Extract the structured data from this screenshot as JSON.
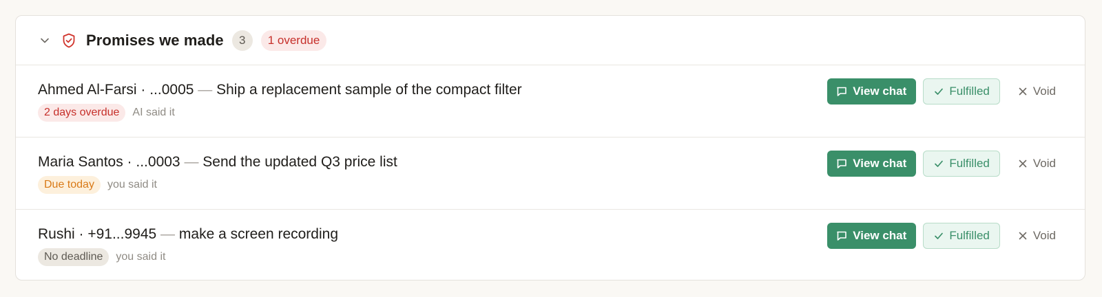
{
  "colors": {
    "accent": "#3a8f69",
    "danger": "#c62f2a",
    "warning": "#d97a17",
    "neutral_text": "#5e5a53"
  },
  "header": {
    "collapse_icon": "chevron-down-icon",
    "icon": "shield-check-icon",
    "title": "Promises we made",
    "count": "3",
    "overdue_label": "1 overdue"
  },
  "actions": {
    "view_chat": "View chat",
    "view_chat_icon": "chat-bubble-icon",
    "fulfilled": "Fulfilled",
    "fulfilled_icon": "check-icon",
    "void": "Void",
    "void_icon": "close-icon"
  },
  "promises": [
    {
      "contact": "Ahmed Al-Farsi · ...0005",
      "separator": "—",
      "promise": "Ship a replacement sample of the compact filter",
      "status": "2 days overdue",
      "status_kind": "overdue",
      "said_by": "AI said it"
    },
    {
      "contact": "Maria Santos · ...0003",
      "separator": "—",
      "promise": "Send the updated Q3 price list",
      "status": "Due today",
      "status_kind": "due",
      "said_by": "you said it"
    },
    {
      "contact": "Rushi · +91...9945",
      "separator": "—",
      "promise": "make a screen recording",
      "status": "No deadline",
      "status_kind": "none",
      "said_by": "you said it"
    }
  ]
}
